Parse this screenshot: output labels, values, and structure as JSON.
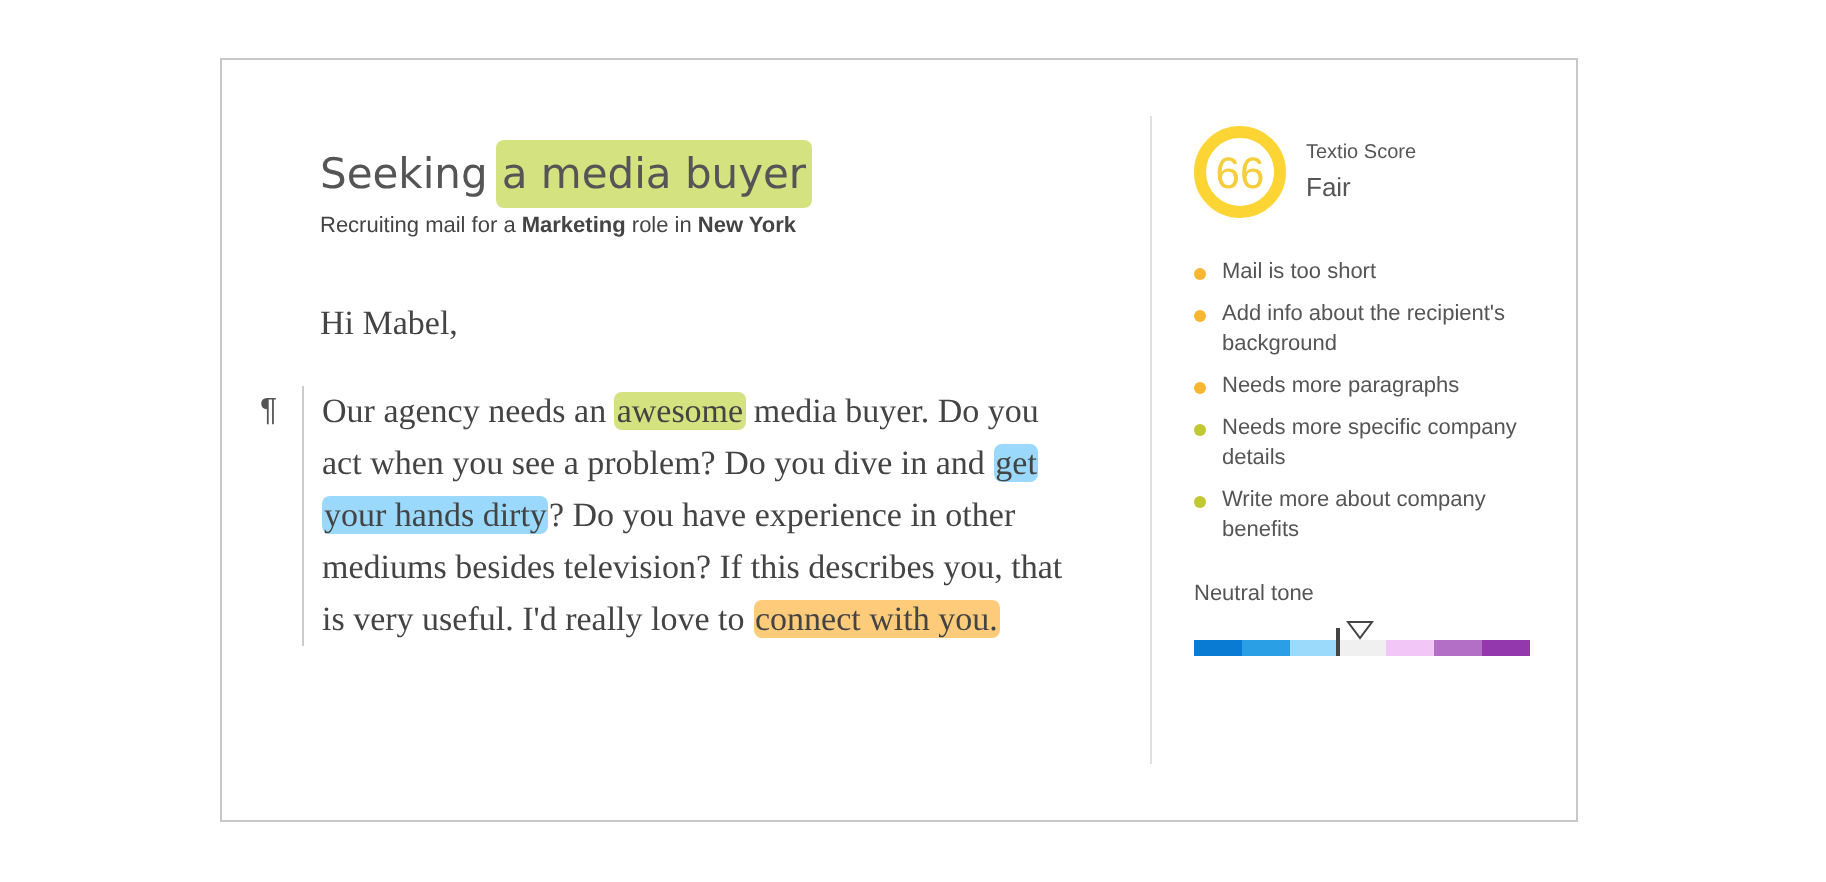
{
  "editor": {
    "title": "Seeking",
    "title_highlight": {
      "text": "a media buyer",
      "color": "#d4e27f"
    },
    "subtitle": "Recruiting mail for a **Marketing** role in **New York**",
    "greeting": "Hi Mabel,",
    "paragraph_mark": "¶",
    "paragraph": [
      {
        "text": "Our agency needs an "
      },
      {
        "text": "awesome",
        "color": "#d4e27f"
      },
      {
        "text": " media buyer. Do you act when you see a problem? Do you dive in and "
      },
      {
        "text": "get",
        "color": "#9ad9fb"
      },
      {
        "text": "your hands dirty",
        "color": "#9ad9fb",
        "space_before": true
      },
      {
        "text": "? Do you have experience in other mediums besides television? If this describes you, that is very useful. I'd really love to "
      },
      {
        "text": "connect with you.",
        "color": "#fdcb7a"
      }
    ]
  },
  "score": {
    "value": "66",
    "label": "Textio Score",
    "rating": "Fair"
  },
  "suggestions": [
    {
      "text": "Mail is too short",
      "color": "#f7b733"
    },
    {
      "text": "Add info about the recipient's background",
      "color": "#f7b733"
    },
    {
      "text": "Needs more paragraphs",
      "color": "#f7b733"
    },
    {
      "text": "Needs more specific company details",
      "color": "#c1c730"
    },
    {
      "text": "Write more about company benefits",
      "color": "#c1c730"
    }
  ],
  "tone": {
    "label": "Neutral tone",
    "segments": [
      {
        "color": "#0a7bd3"
      },
      {
        "color": "#2b9fe6"
      },
      {
        "color": "#9bdafa"
      },
      {
        "color": "#f0f0f0"
      },
      {
        "color": "#f2c6f6"
      },
      {
        "color": "#b36fc6"
      },
      {
        "color": "#9339ad"
      }
    ]
  }
}
